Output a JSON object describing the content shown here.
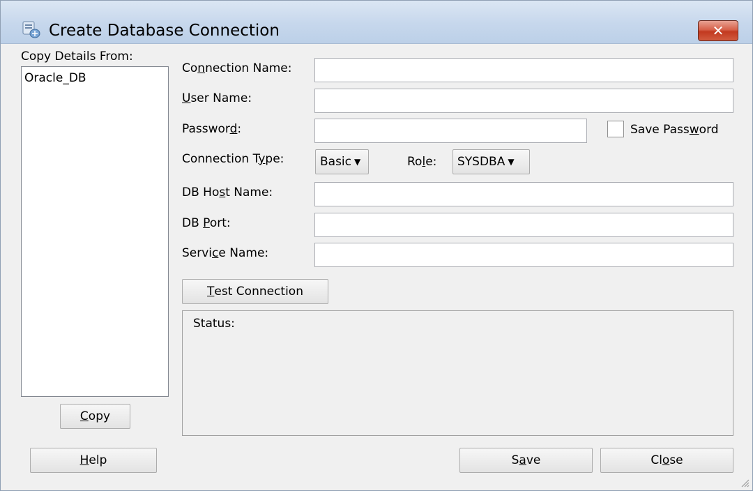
{
  "window": {
    "title": "Create Database Connection",
    "app_icon": "database-connection-icon",
    "close_symbol": "✕"
  },
  "copy_panel": {
    "label": "Copy Details From:",
    "items": [
      "Oracle_DB"
    ],
    "copy_button": {
      "underline": "C",
      "rest": "opy"
    }
  },
  "form": {
    "connection_name": {
      "label": [
        "Co",
        "n",
        "nection Name:"
      ],
      "value": ""
    },
    "user_name": {
      "label": [
        "",
        "U",
        "ser Name:"
      ],
      "value": ""
    },
    "password": {
      "label": [
        "Passwor",
        "d",
        ":"
      ],
      "value": ""
    },
    "save_password": {
      "label": [
        "Save Pass",
        "w",
        "ord"
      ],
      "checked": false
    },
    "connection_type": {
      "label": [
        "Connection T",
        "y",
        "pe:"
      ],
      "value": "Basic"
    },
    "role": {
      "label": [
        "Ro",
        "l",
        "e:"
      ],
      "value": "SYSDBA"
    },
    "db_host_name": {
      "label": [
        "DB Ho",
        "s",
        "t Name:"
      ],
      "value": ""
    },
    "db_port": {
      "label": [
        "DB ",
        "P",
        "ort:"
      ],
      "value": ""
    },
    "service_name": {
      "label": [
        "Servi",
        "c",
        "e Name:"
      ],
      "value": ""
    },
    "test_connection": {
      "underline": "T",
      "rest": "est Connection"
    },
    "status_label": "Status:"
  },
  "footer": {
    "help": {
      "underline": "H",
      "rest": "elp"
    },
    "save": {
      "pre": "S",
      "underline": "a",
      "rest": "ve"
    },
    "close": {
      "pre": "Cl",
      "underline": "o",
      "rest": "se"
    }
  },
  "dropdown_arrow": "▼"
}
